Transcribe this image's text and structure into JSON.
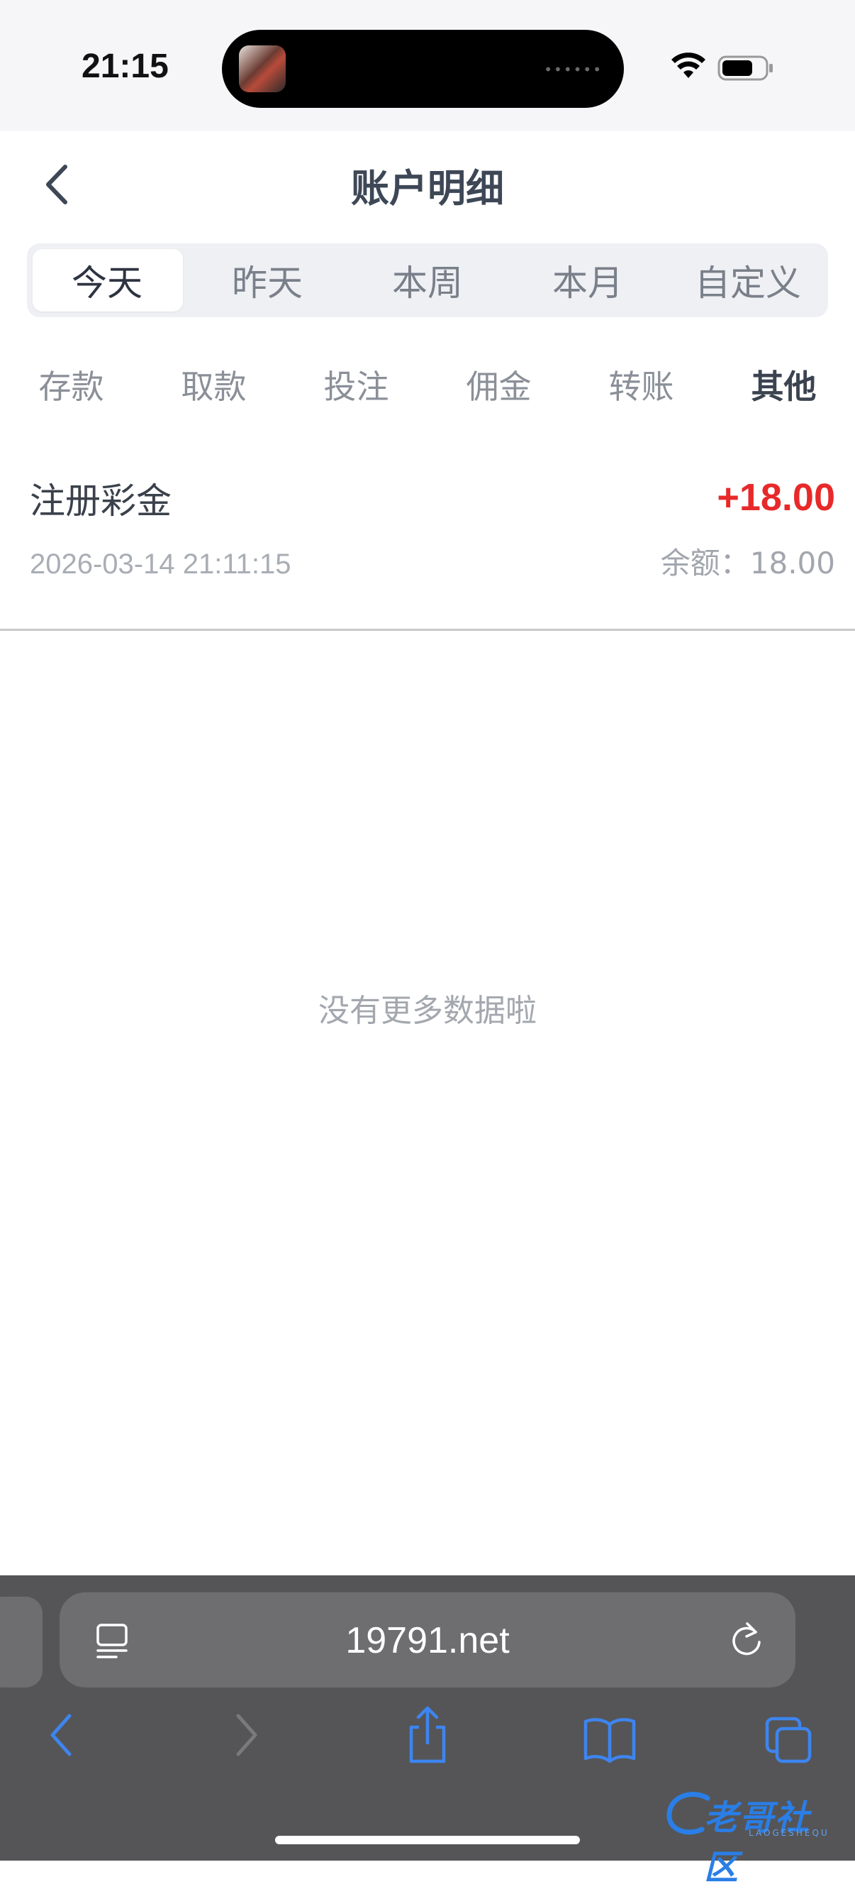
{
  "status_bar": {
    "time": "21:15"
  },
  "header": {
    "title": "账户明细"
  },
  "period_tabs": [
    {
      "label": "今天",
      "active": true
    },
    {
      "label": "昨天",
      "active": false
    },
    {
      "label": "本周",
      "active": false
    },
    {
      "label": "本月",
      "active": false
    },
    {
      "label": "自定义",
      "active": false
    }
  ],
  "category_tabs": [
    {
      "label": "存款",
      "active": false
    },
    {
      "label": "取款",
      "active": false
    },
    {
      "label": "投注",
      "active": false
    },
    {
      "label": "佣金",
      "active": false
    },
    {
      "label": "转账",
      "active": false
    },
    {
      "label": "其他",
      "active": true
    }
  ],
  "transactions": [
    {
      "name": "注册彩金",
      "amount": "+18.00",
      "datetime": "2026-03-14 21:11:15",
      "balance": "余额：18.00"
    }
  ],
  "empty_message": "没有更多数据啦",
  "browser": {
    "url": "19791.net"
  },
  "watermark": {
    "text": "老哥社区",
    "subtext": "LAOGESHEQU"
  },
  "colors": {
    "accent_amount": "#e8292a",
    "title": "#3e4756",
    "browser_chrome": "#555557",
    "toolbar_icons": "#3d85f0"
  }
}
